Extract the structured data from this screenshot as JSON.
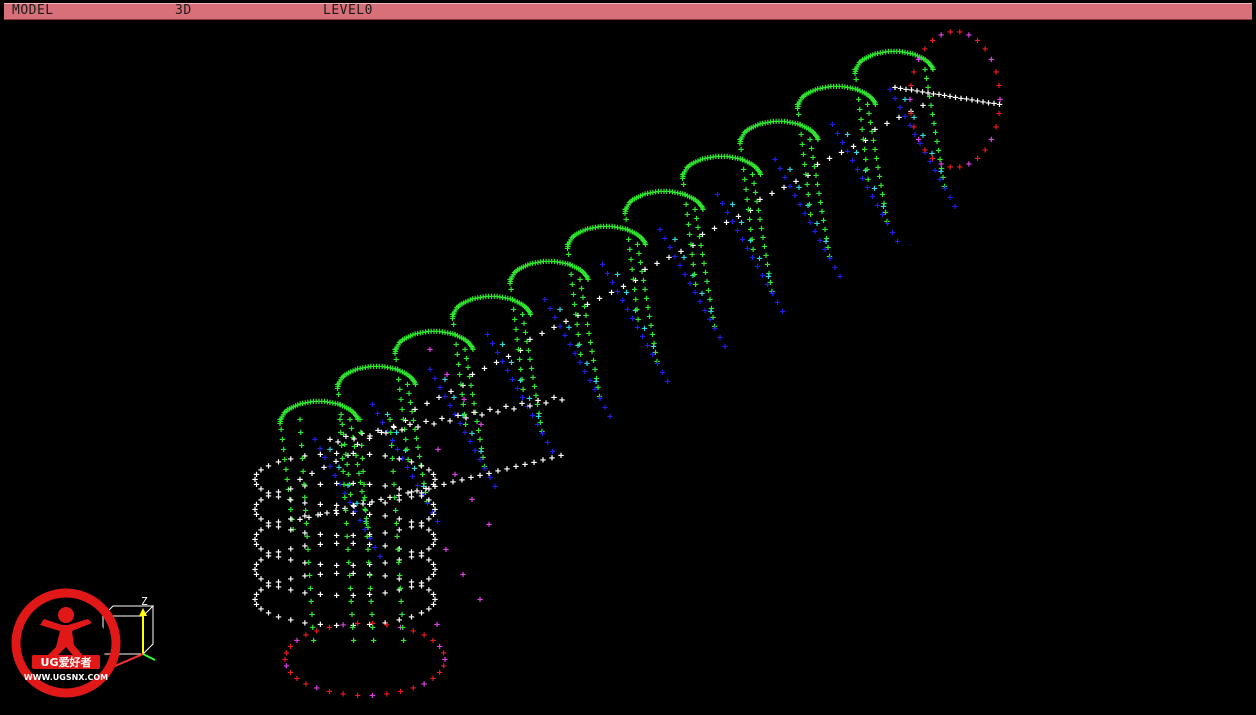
{
  "status_bar": {
    "model_label": "MODEL",
    "space_label": "3D",
    "level_label": "LEVEL0"
  },
  "axis_triad": {
    "z_label": "Z"
  },
  "watermark": {
    "logo_text": "UG爱好者",
    "url_text": "WWW.UGSNX.COM"
  },
  "point_colors": {
    "green": "#2ee82e",
    "white": "#ffffff",
    "blue": "#1f1fe8",
    "cyan": "#30d8e0",
    "magenta": "#e040e8",
    "red": "#e81c1c"
  },
  "point_marker": "+"
}
